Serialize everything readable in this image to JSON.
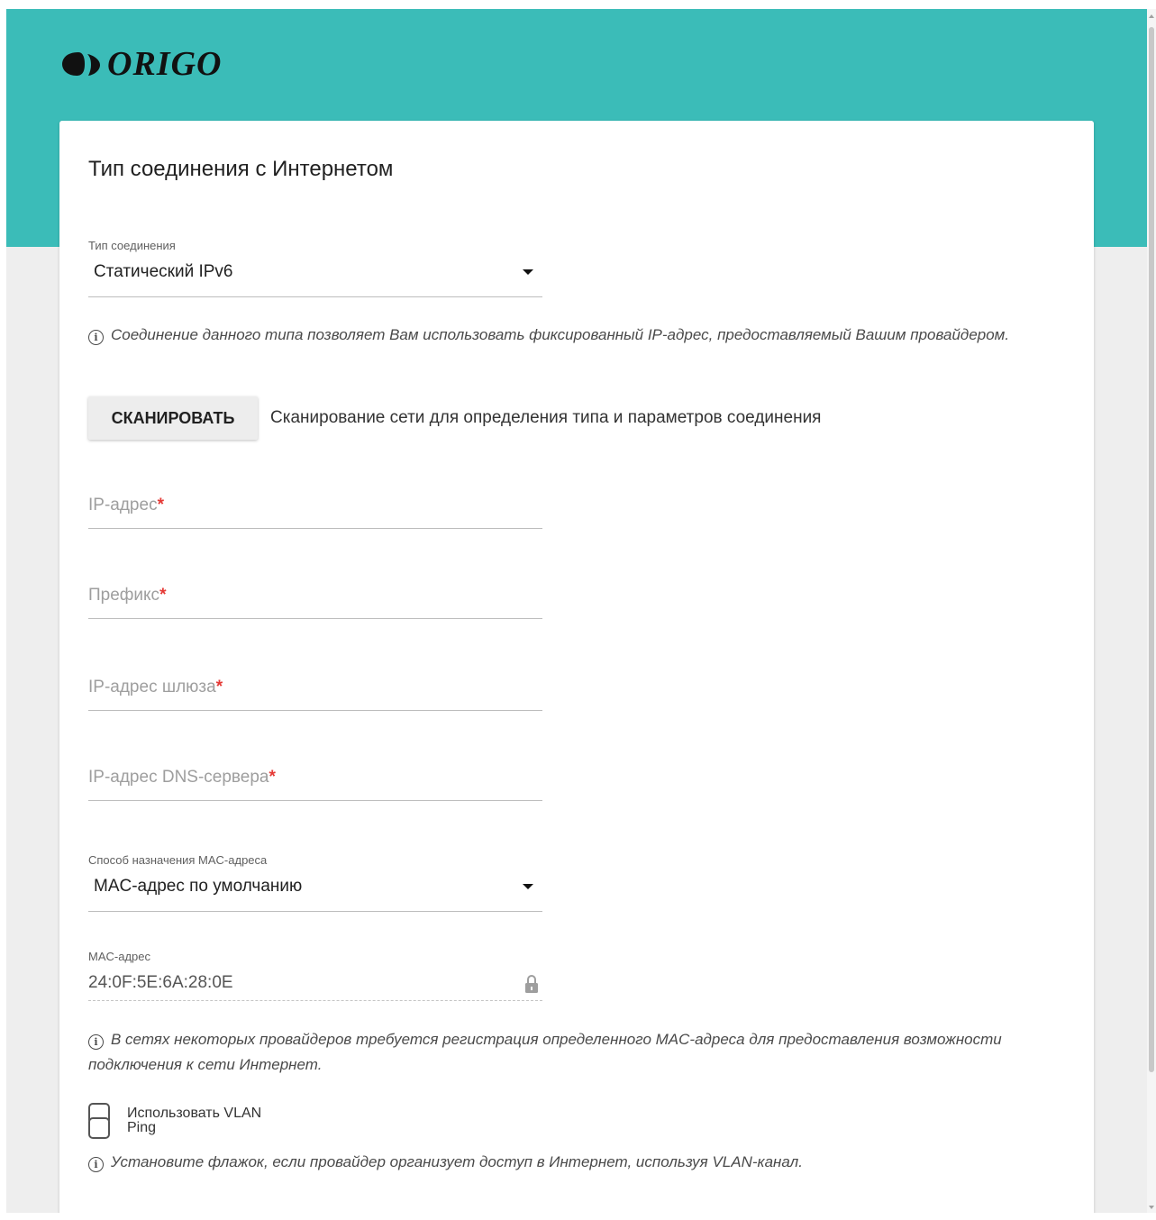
{
  "brand": {
    "name": "ORIGO",
    "logo_icon": "origo-logo-icon"
  },
  "colors": {
    "header": "#3bbcb8",
    "required": "#e53935",
    "background": "#eeeeee",
    "card": "#ffffff"
  },
  "page": {
    "title": "Тип соединения с Интернетом"
  },
  "connection_type": {
    "label": "Тип соединения",
    "value": "Статический IPv6",
    "icon": "chevron-down-icon"
  },
  "info_connection": {
    "text": "Соединение данного типа позволяет Вам использовать фиксированный IP-адрес, предоставляемый Вашим провайдером.",
    "icon": "info-icon"
  },
  "scan": {
    "button_label": "СКАНИРОВАТЬ",
    "description": "Сканирование сети для определения типа и параметров соединения"
  },
  "fields": {
    "ip_address": {
      "placeholder": "IP-адрес",
      "required_mark": "*"
    },
    "prefix": {
      "placeholder": "Префикс",
      "required_mark": "*"
    },
    "gateway": {
      "placeholder": "IP-адрес шлюза",
      "required_mark": "*"
    },
    "dns": {
      "placeholder": "IP-адрес DNS-сервера",
      "required_mark": "*"
    }
  },
  "mac_method": {
    "label": "Способ назначения MAC-адреса",
    "value": "MAC-адрес по умолчанию",
    "icon": "chevron-down-icon"
  },
  "mac_address": {
    "label": "MAC-адрес",
    "value": "24:0F:5E:6A:28:0E",
    "icon": "lock-icon"
  },
  "info_mac": {
    "text": "В сетях некоторых провайдеров требуется регистрация определенного MAC-адреса для предоставления возможности подключения к сети Интернет.",
    "icon": "info-icon"
  },
  "vlan": {
    "label": "Использовать VLAN",
    "checked": false
  },
  "info_vlan": {
    "text": "Установите флажок, если провайдер организует доступ в Интернет, используя VLAN-канал.",
    "icon": "info-icon"
  },
  "ping": {
    "label": "Ping",
    "checked": false
  }
}
